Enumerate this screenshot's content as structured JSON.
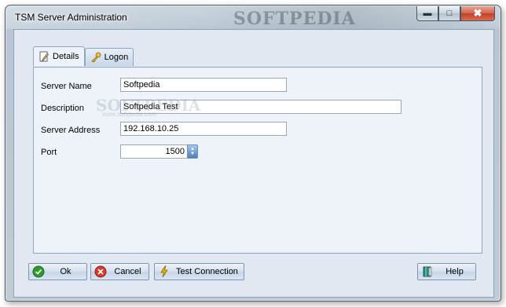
{
  "window": {
    "title": "TSM Server Administration",
    "watermark": "SOFTPEDIA",
    "controls": {
      "minimize_icon": "minimize-icon",
      "maximize_icon": "maximize-icon",
      "close_icon": "close-icon"
    }
  },
  "tabs": [
    {
      "label": "Details",
      "icon": "pencil-icon",
      "active": true
    },
    {
      "label": "Logon",
      "icon": "key-icon",
      "active": false
    }
  ],
  "form": {
    "server_name": {
      "label": "Server Name",
      "value": "Softpedia"
    },
    "description": {
      "label": "Description",
      "value": "Softpedia Test"
    },
    "server_address": {
      "label": "Server Address",
      "value": "192.168.10.25"
    },
    "port": {
      "label": "Port",
      "value": "1500"
    }
  },
  "watermark": {
    "text": "SOFTPEDIA",
    "sub": "www.softpedia.com"
  },
  "buttons": {
    "ok": {
      "label": "Ok",
      "icon": "check-icon",
      "color": "#2e9a2a"
    },
    "cancel": {
      "label": "Cancel",
      "icon": "cancel-icon",
      "color": "#d63a2a"
    },
    "test": {
      "label": "Test Connection",
      "icon": "lightning-icon",
      "color": "#f0b400"
    },
    "help": {
      "label": "Help",
      "icon": "help-book-icon",
      "color": "#2d8a7a"
    }
  }
}
